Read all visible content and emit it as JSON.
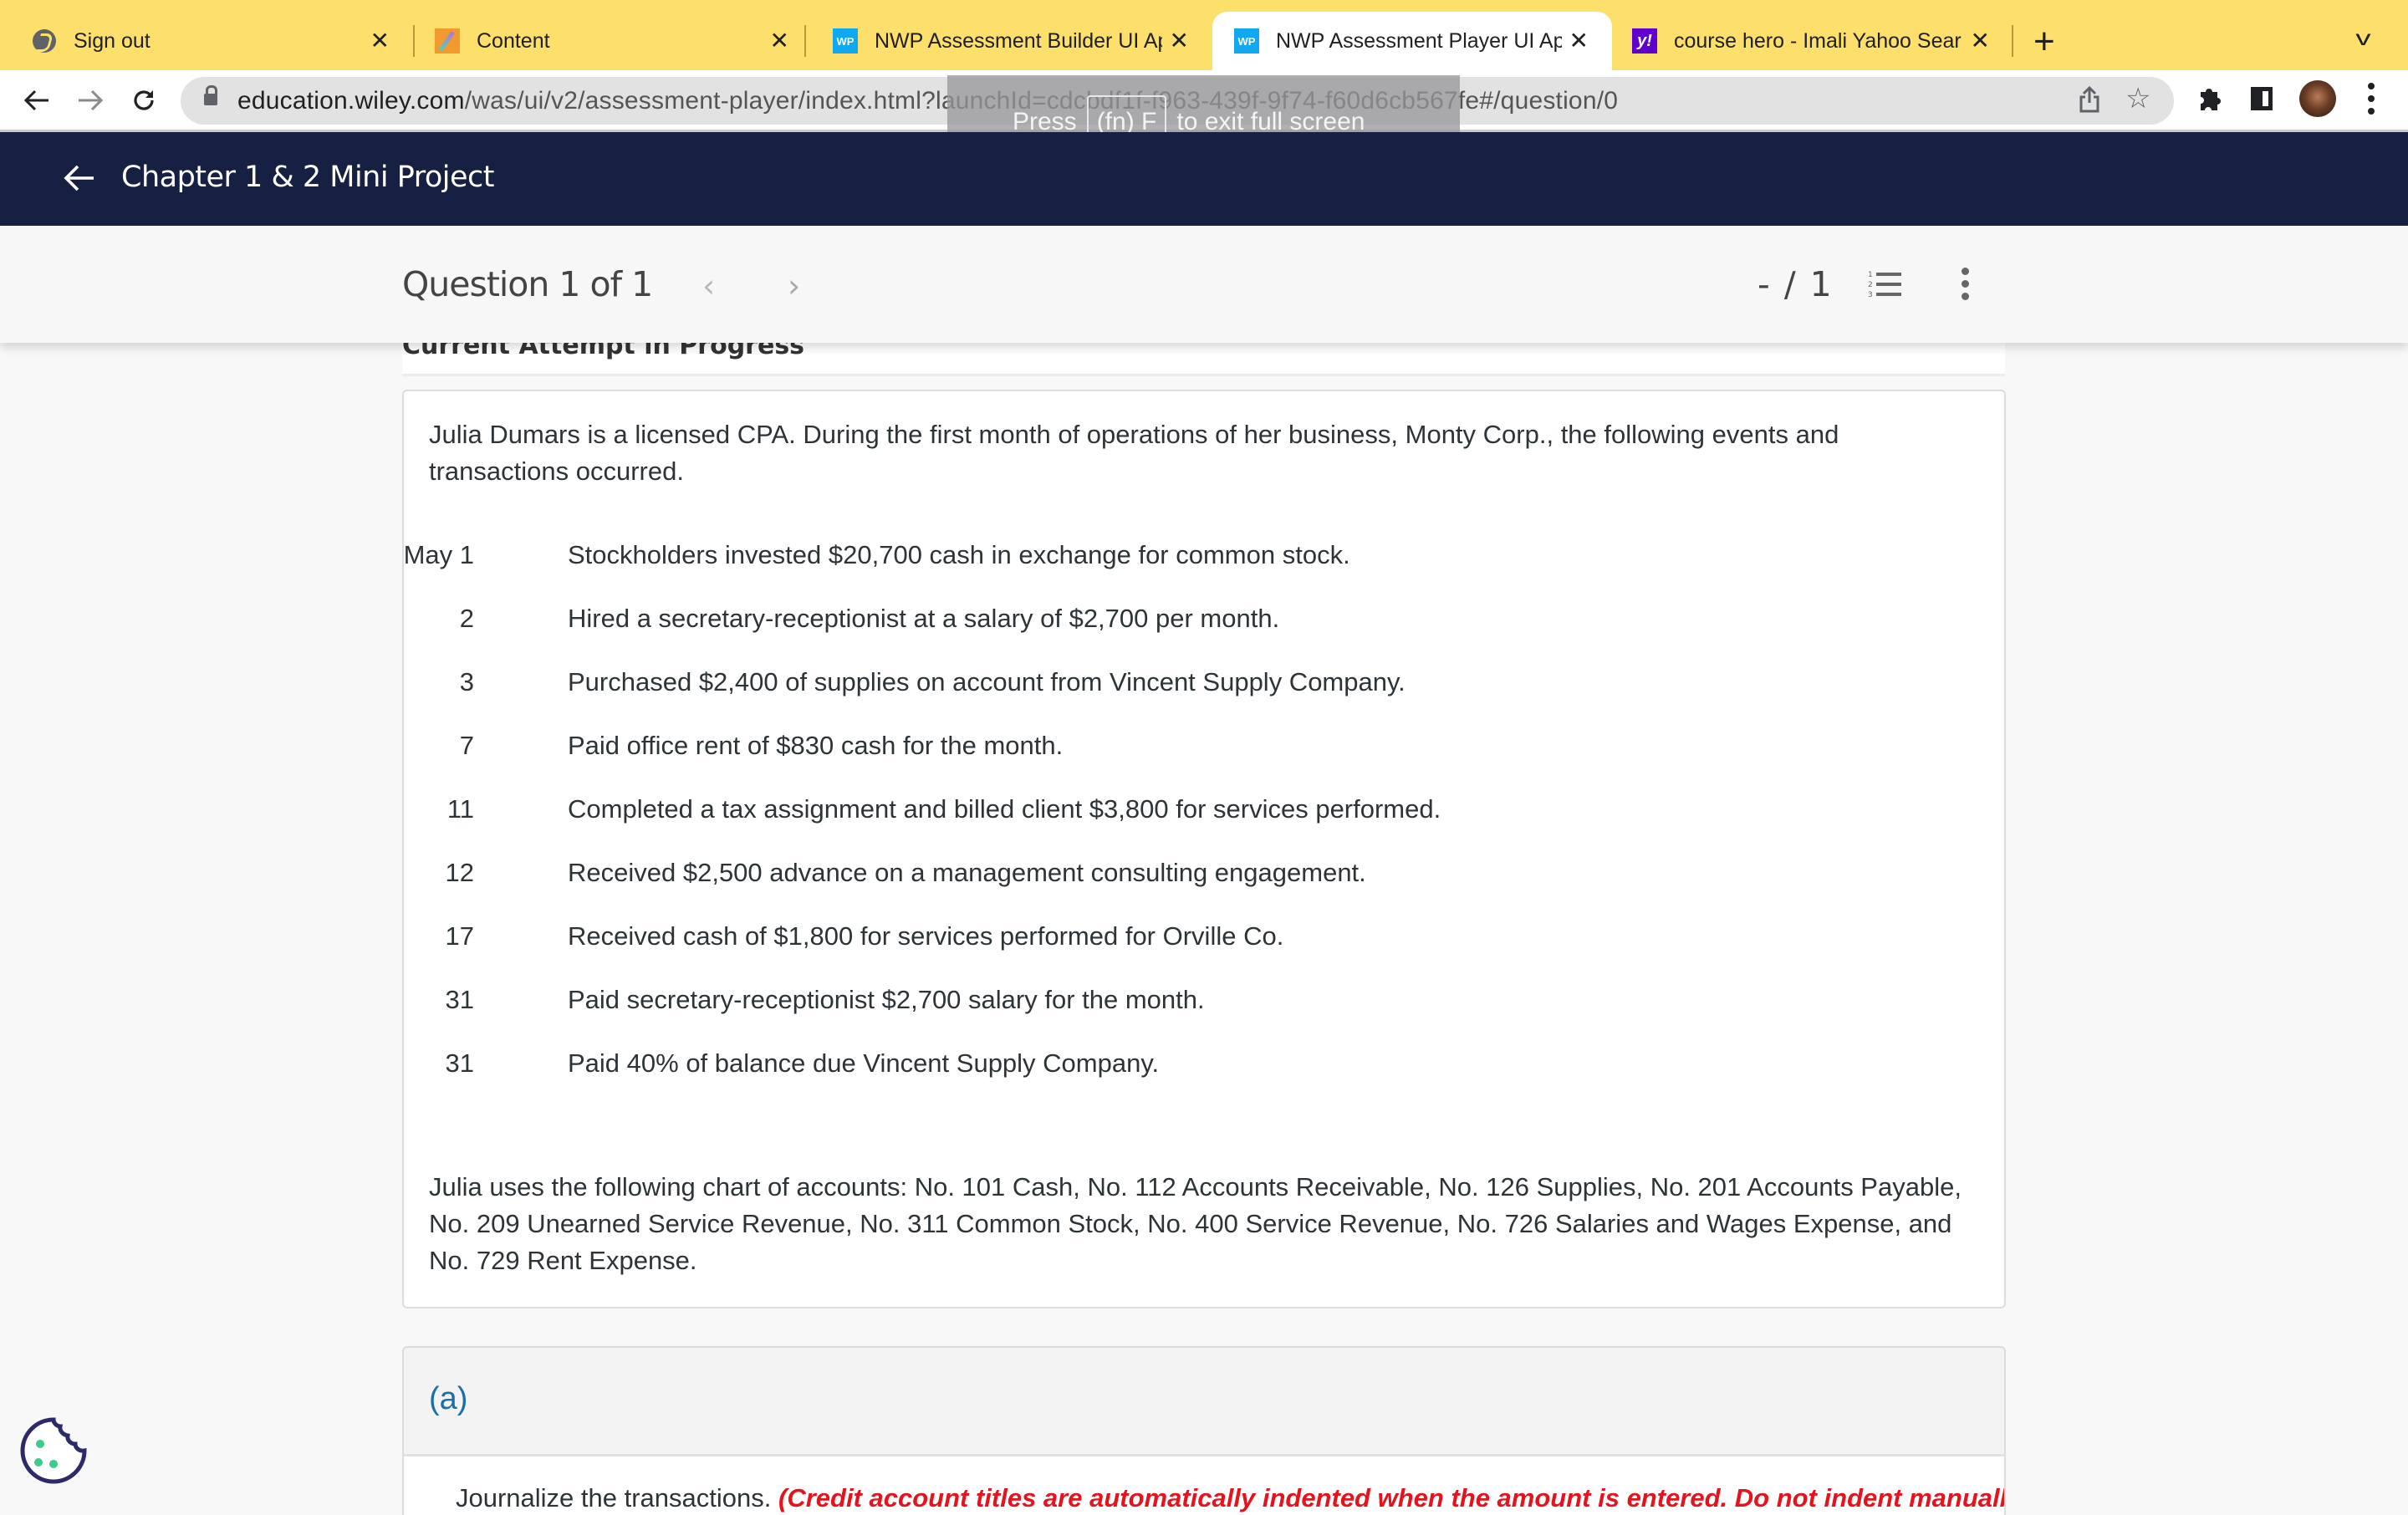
{
  "browser": {
    "tabs": [
      {
        "title": "Sign out",
        "icon": "globe-icon",
        "active": false
      },
      {
        "title": "Content",
        "icon": "pencil-icon",
        "active": false
      },
      {
        "title": "NWP Assessment Builder UI Ap",
        "icon": "wp-icon",
        "icon_text": "WP",
        "active": false
      },
      {
        "title": "NWP Assessment Player UI Ap",
        "icon": "wp-icon",
        "icon_text": "WP",
        "active": true
      },
      {
        "title": "course hero - Imali Yahoo Sear",
        "icon": "yahoo-icon",
        "icon_text": "y!",
        "active": false
      }
    ],
    "close_glyph": "✕",
    "new_tab_glyph": "+",
    "url_host": "education.wiley.com",
    "url_path": "/was/ui/v2/assessment-player/index.html?launchId=cdcbdf1f-f963-439f-9f74-f60d6cb567fe#/question/0",
    "fullscreen_toast": {
      "pre": "Press",
      "key": "(fn) F",
      "post": "to exit full screen"
    },
    "tab_bar_color": "#fddf6b"
  },
  "header": {
    "title": "Chapter 1 & 2 Mini Project",
    "background": "#152043"
  },
  "question_nav": {
    "label": "Question 1 of 1",
    "prev_glyph": "‹",
    "next_glyph": "›",
    "score": "- / 1"
  },
  "attempt_status": "Current Attempt in Progress",
  "problem": {
    "intro": "Julia Dumars is a licensed CPA. During the first month of operations of her business, Monty Corp., the following events and transactions occurred.",
    "transactions": [
      {
        "date": "May 1",
        "description": "Stockholders invested $20,700 cash in exchange for common stock."
      },
      {
        "date": "2",
        "description": "Hired a secretary-receptionist at a salary of $2,700 per month."
      },
      {
        "date": "3",
        "description": "Purchased $2,400 of supplies on account from Vincent Supply Company."
      },
      {
        "date": "7",
        "description": "Paid office rent of $830 cash for the month."
      },
      {
        "date": "11",
        "description": "Completed a tax assignment and billed client $3,800 for services performed."
      },
      {
        "date": "12",
        "description": "Received $2,500 advance on a management consulting engagement."
      },
      {
        "date": "17",
        "description": "Received cash of $1,800 for services performed for Orville Co."
      },
      {
        "date": "31",
        "description": "Paid secretary-receptionist $2,700 salary for the month."
      },
      {
        "date": "31",
        "description": "Paid 40% of balance due Vincent Supply Company."
      }
    ],
    "chart_of_accounts": "Julia uses the following chart of accounts: No. 101 Cash, No. 112 Accounts Receivable, No. 126 Supplies, No. 201 Accounts Payable, No. 209 Unearned Service Revenue, No. 311 Common Stock, No. 400 Service Revenue, No. 726 Salaries and Wages Expense, and No. 729 Rent Expense."
  },
  "part_a": {
    "label": "(a)",
    "instruction": "Journalize the transactions.",
    "note": "(Credit account titles are automatically indented when the amount is entered. Do not indent manually."
  }
}
